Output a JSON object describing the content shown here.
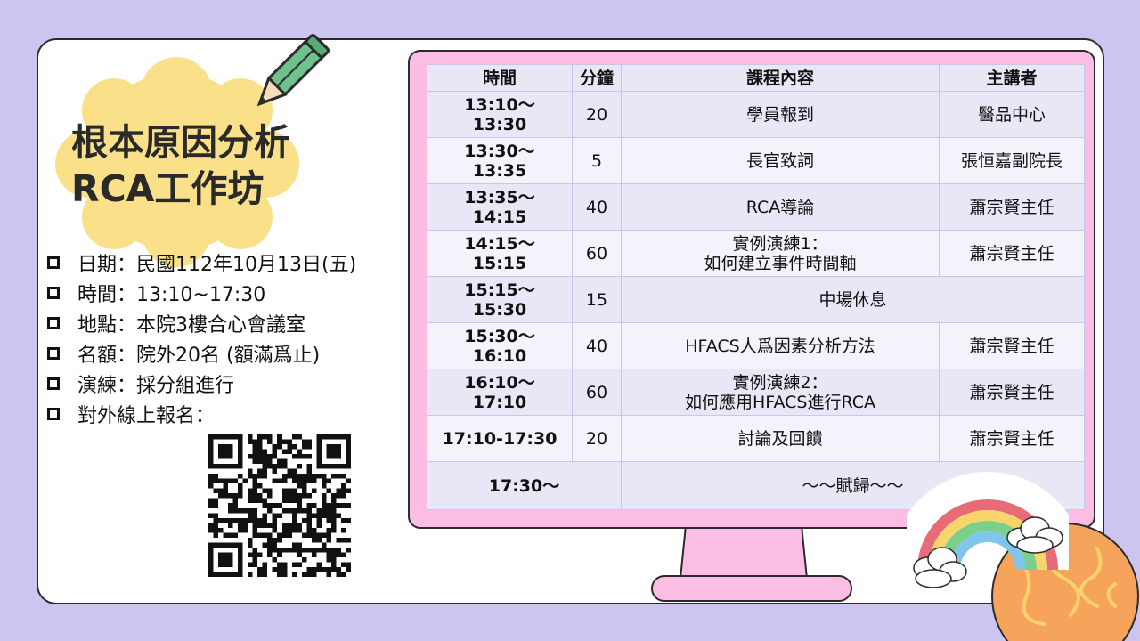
{
  "title": {
    "line1": "根本原因分析",
    "line2": "RCA工作坊"
  },
  "info": [
    "日期：民國112年10月13日(五)",
    "時間：13:10~17:30",
    "地點：本院3樓合心會議室",
    "名額：院外20名 (額滿爲止)",
    "演練：採分組進行",
    "對外線上報名："
  ],
  "schedule": {
    "headers": [
      "時間",
      "分鐘",
      "課程內容",
      "主講者"
    ],
    "rows": [
      {
        "time": "13:10～\n13:30",
        "minutes": "20",
        "content": "學員報到",
        "speaker": "醫品中心"
      },
      {
        "time": "13:30～\n13:35",
        "minutes": "5",
        "content": "長官致詞",
        "speaker": "張恒嘉副院長"
      },
      {
        "time": "13:35～\n14:15",
        "minutes": "40",
        "content": "RCA導論",
        "speaker": "蕭宗賢主任"
      },
      {
        "time": "14:15～\n15:15",
        "minutes": "60",
        "content": "實例演練1：\n如何建立事件時間軸",
        "speaker": "蕭宗賢主任"
      },
      {
        "time": "15:15～\n15:30",
        "minutes": "15",
        "content": "中場休息",
        "speaker": ""
      },
      {
        "time": "15:30～\n16:10",
        "minutes": "40",
        "content": "HFACS人爲因素分析方法",
        "speaker": "蕭宗賢主任"
      },
      {
        "time": "16:10～\n17:10",
        "minutes": "60",
        "content": "實例演練2：\n如何應用HFACS進行RCA",
        "speaker": "蕭宗賢主任"
      },
      {
        "time": "17:10-17:30",
        "minutes": "20",
        "content": "討論及回饋",
        "speaker": "蕭宗賢主任"
      }
    ],
    "final": {
      "time": "17:30～",
      "content": "～～賦歸～～"
    }
  },
  "colors": {
    "background": "#cdc5ef",
    "monitor": "#fbbde3",
    "blob": "#fbe08a",
    "row_odd": "#e9e7f6",
    "row_even": "#f4f3fb"
  },
  "icons": [
    "pencil-icon",
    "qr-code",
    "rainbow-icon",
    "cloud-icon",
    "planet-icon"
  ]
}
